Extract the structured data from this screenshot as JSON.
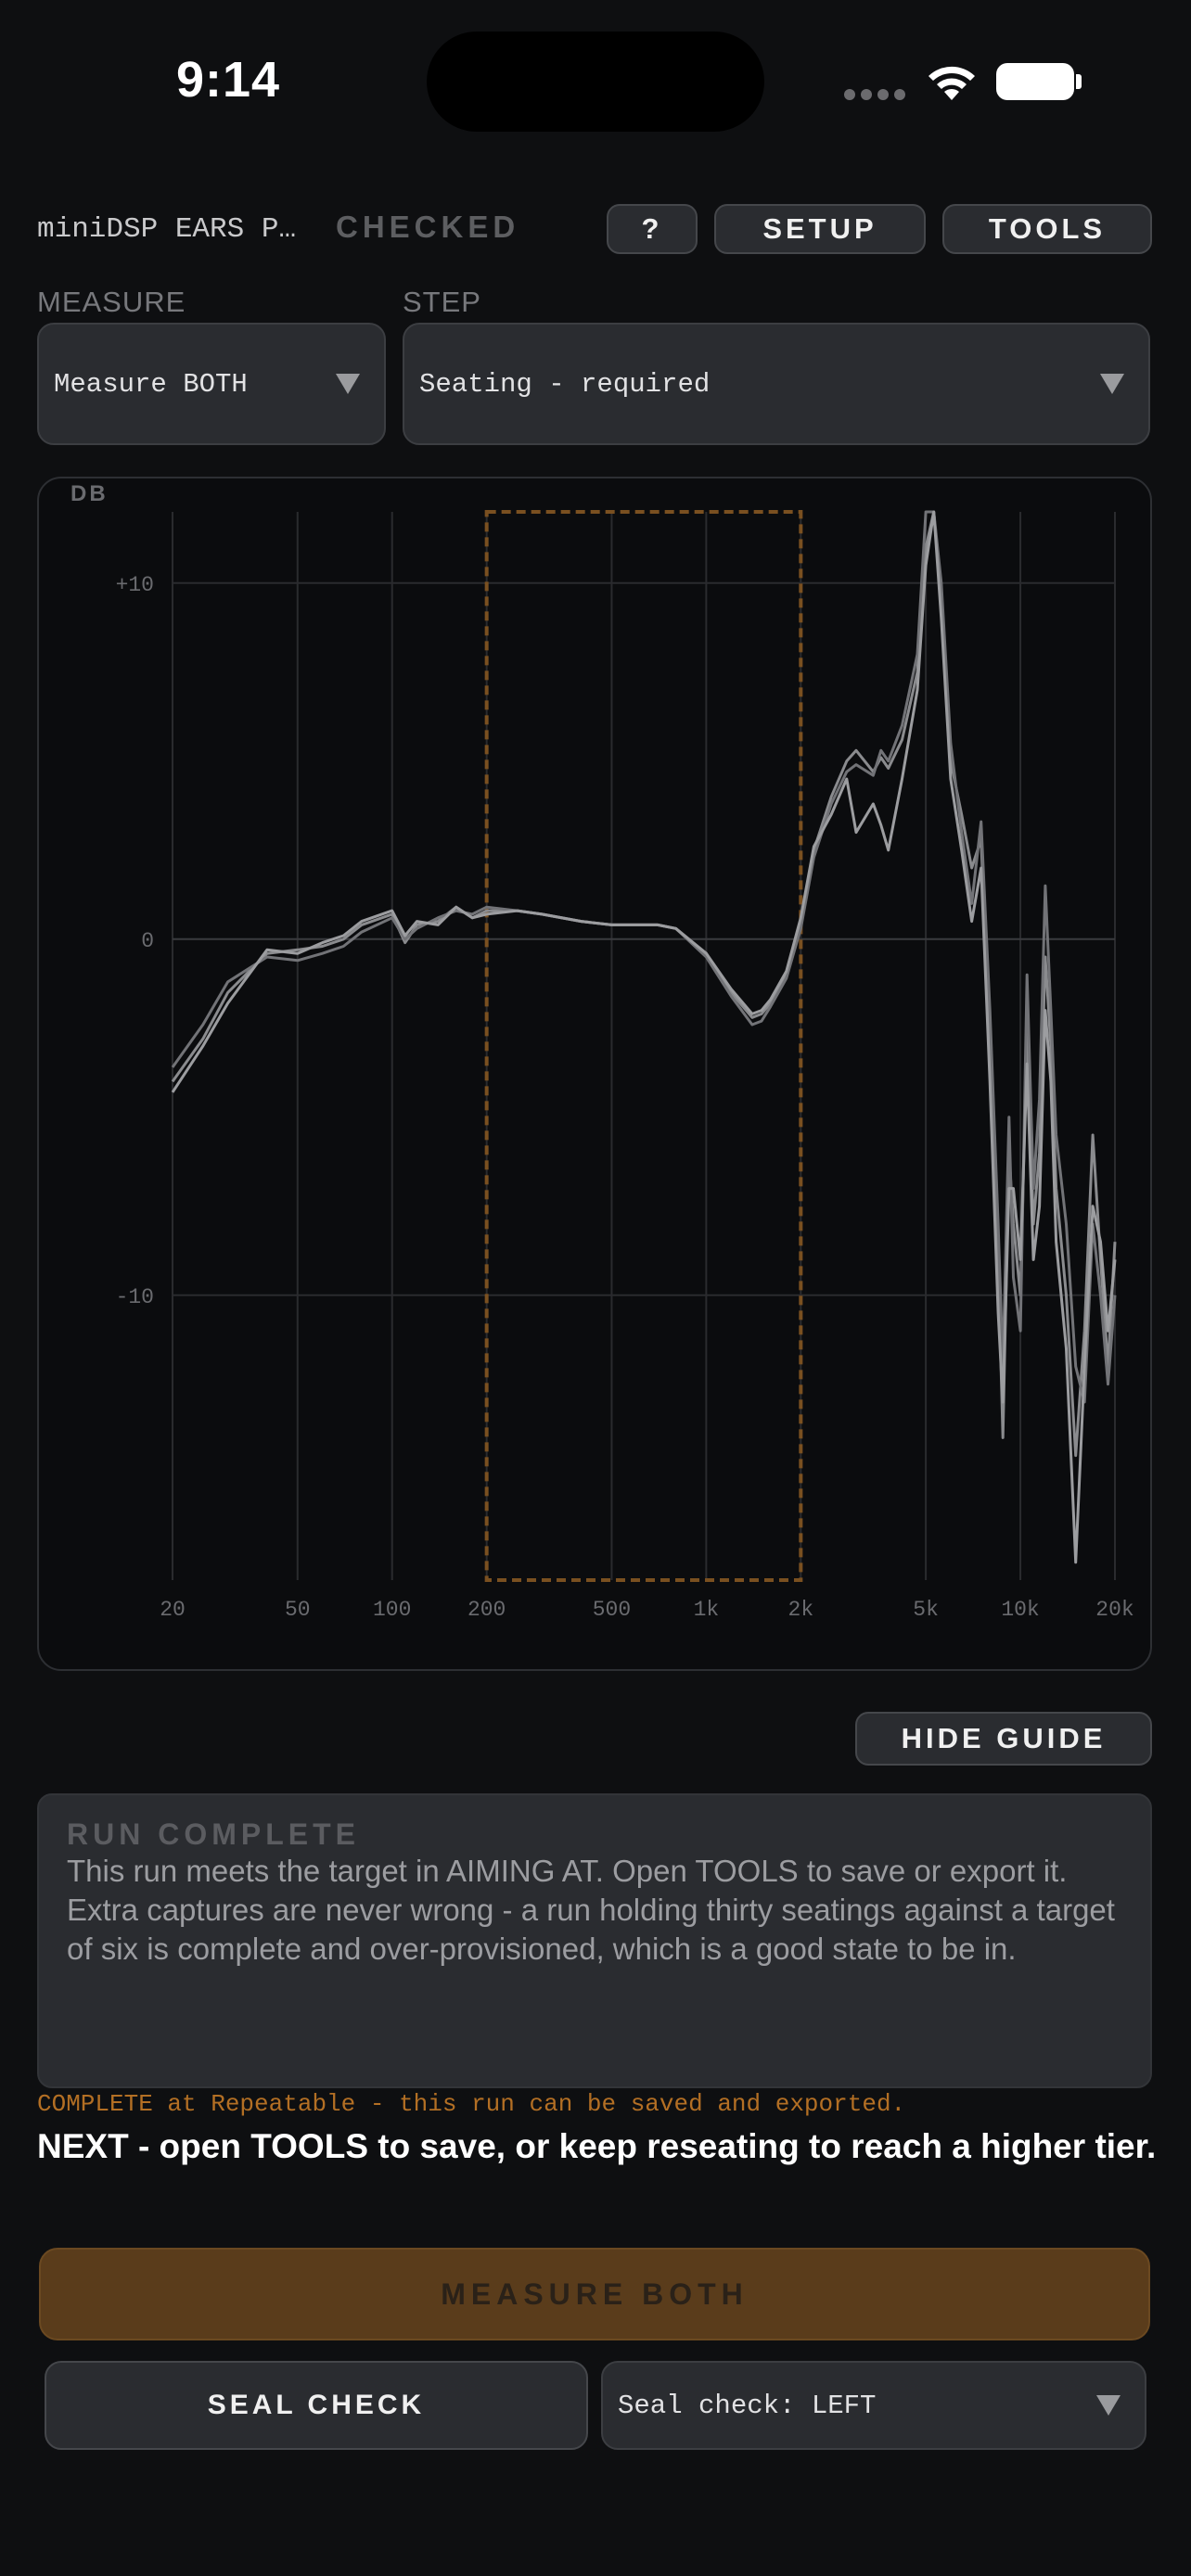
{
  "status_bar": {
    "time": "9:14"
  },
  "header": {
    "device_name": "miniDSP EARS P…",
    "status": "CHECKED",
    "help_label": "?",
    "setup_label": "SETUP",
    "tools_label": "TOOLS"
  },
  "measure": {
    "label": "MEASURE",
    "value": "Measure BOTH"
  },
  "step": {
    "label": "STEP",
    "value": "Seating - required"
  },
  "chart_data": {
    "type": "line",
    "ylabel": "DB",
    "x_scale": "log",
    "xlim": [
      20,
      20000
    ],
    "ylim": [
      -18,
      12
    ],
    "y_ticks": [
      "+10",
      "0",
      "-10"
    ],
    "y_tick_values": [
      10,
      0,
      -10
    ],
    "x_ticks": [
      "20",
      "50",
      "100",
      "200",
      "500",
      "1k",
      "2k",
      "5k",
      "10k",
      "20k"
    ],
    "x_tick_values": [
      20,
      50,
      100,
      200,
      500,
      1000,
      2000,
      5000,
      10000,
      20000
    ],
    "highlight_range": [
      200,
      2000
    ],
    "grid": true,
    "series": [
      {
        "x": [
          20,
          25,
          30,
          40,
          50,
          60,
          70,
          80,
          100,
          110,
          120,
          140,
          160,
          180,
          200,
          250,
          300,
          400,
          500,
          600,
          700,
          800,
          1000,
          1200,
          1400,
          1500,
          1600,
          1800,
          2000,
          2200,
          2500,
          2800,
          3000,
          3400,
          3600,
          3800,
          4200,
          4700,
          5000,
          5300,
          5600,
          6000,
          6500,
          7000,
          7500,
          8000,
          8500,
          8800,
          9200,
          9500,
          10000,
          10500,
          11000,
          11500,
          12000,
          12500,
          13000,
          14000,
          15000,
          16000,
          17000,
          18000,
          19000,
          20000
        ],
        "y": [
          -4.0,
          -2.8,
          -1.5,
          -0.4,
          -0.3,
          -0.2,
          0.0,
          0.4,
          0.7,
          -0.1,
          0.4,
          0.5,
          0.9,
          0.6,
          0.8,
          0.8,
          0.7,
          0.5,
          0.4,
          0.4,
          0.4,
          0.3,
          -0.4,
          -1.5,
          -2.2,
          -2.1,
          -1.8,
          -1.0,
          0.5,
          2.5,
          4.0,
          5.0,
          5.3,
          4.7,
          5.1,
          4.8,
          5.6,
          7.5,
          11.0,
          12.0,
          9.5,
          5.0,
          3.5,
          2.0,
          2.8,
          -3.0,
          -9.0,
          -14.0,
          -6.0,
          -8.0,
          -10.0,
          -2.5,
          -8.0,
          -6.0,
          -0.5,
          -3.0,
          -7.0,
          -10.0,
          -14.5,
          -11.0,
          -5.5,
          -9.0,
          -12.0,
          -8.5
        ]
      },
      {
        "x": [
          20,
          25,
          30,
          40,
          50,
          60,
          70,
          80,
          100,
          110,
          120,
          140,
          160,
          180,
          200,
          250,
          300,
          400,
          500,
          600,
          700,
          800,
          1000,
          1200,
          1400,
          1500,
          1600,
          1800,
          2000,
          2200,
          2500,
          2800,
          3000,
          3400,
          3600,
          3800,
          4200,
          4700,
          5000,
          5300,
          5600,
          6000,
          6500,
          7000,
          7500,
          8000,
          8500,
          8800,
          9200,
          9500,
          10000,
          10500,
          11000,
          11500,
          12000,
          12500,
          13000,
          14000,
          15000,
          16000,
          17000,
          18000,
          19000,
          20000
        ],
        "y": [
          -3.6,
          -2.4,
          -1.2,
          -0.5,
          -0.6,
          -0.4,
          -0.2,
          0.2,
          0.6,
          0.0,
          0.3,
          0.6,
          0.8,
          0.7,
          0.9,
          0.8,
          0.7,
          0.5,
          0.4,
          0.4,
          0.4,
          0.3,
          -0.5,
          -1.6,
          -2.4,
          -2.3,
          -1.9,
          -1.1,
          0.3,
          2.3,
          3.8,
          4.7,
          4.9,
          4.6,
          5.3,
          5.0,
          6.0,
          8.0,
          12.0,
          12.0,
          10.0,
          5.5,
          3.0,
          1.0,
          3.3,
          -2.0,
          -8.0,
          -12.0,
          -5.0,
          -9.5,
          -11.0,
          -1.0,
          -7.0,
          -4.5,
          1.5,
          -2.0,
          -5.5,
          -8.0,
          -12.0,
          -13.0,
          -8.0,
          -10.0,
          -12.5,
          -10.0
        ]
      },
      {
        "x": [
          20,
          25,
          30,
          40,
          50,
          60,
          70,
          80,
          100,
          110,
          120,
          140,
          160,
          180,
          200,
          250,
          300,
          400,
          500,
          600,
          700,
          800,
          1000,
          1200,
          1400,
          1500,
          1600,
          1800,
          2000,
          2200,
          2500,
          2800,
          3000,
          3400,
          3600,
          3800,
          4200,
          4700,
          5000,
          5300,
          5600,
          6000,
          6500,
          7000,
          7500,
          8000,
          8500,
          8800,
          9200,
          9500,
          10000,
          10500,
          11000,
          11500,
          12000,
          12500,
          13000,
          14000,
          15000,
          16000,
          17000,
          18000,
          19000,
          20000
        ],
        "y": [
          -4.3,
          -3.0,
          -1.8,
          -0.3,
          -0.4,
          -0.1,
          0.1,
          0.5,
          0.8,
          0.1,
          0.5,
          0.4,
          0.9,
          0.6,
          0.7,
          0.8,
          0.7,
          0.5,
          0.4,
          0.4,
          0.4,
          0.3,
          -0.4,
          -1.4,
          -2.1,
          -2.0,
          -1.7,
          -0.9,
          0.6,
          2.6,
          3.5,
          4.5,
          3.0,
          3.8,
          3.2,
          2.5,
          4.5,
          7.0,
          10.5,
          12.0,
          9.0,
          4.5,
          2.5,
          0.5,
          2.0,
          -4.0,
          -10.5,
          -13.0,
          -7.0,
          -7.0,
          -9.0,
          -3.5,
          -9.0,
          -7.5,
          -2.0,
          -4.0,
          -8.5,
          -11.5,
          -17.5,
          -12.0,
          -7.5,
          -8.5,
          -11.0,
          -9.0
        ]
      }
    ]
  },
  "guide": {
    "hide_label": "HIDE GUIDE",
    "title": "RUN COMPLETE",
    "line1": "This run meets the target in AIMING AT. Open TOOLS to save or export it.",
    "line2": "Extra captures are never wrong - a run holding thirty seatings against a target of six is complete and over-provisioned, which is a good state to be in."
  },
  "status_line": "COMPLETE at Repeatable - this run can be saved and exported.",
  "next_line": "NEXT - open TOOLS to save, or keep reseating to reach a higher tier.",
  "actions": {
    "measure_label": "MEASURE BOTH",
    "seal_check_label": "SEAL CHECK",
    "seal_select_value": "Seal check: LEFT"
  },
  "colors": {
    "accent": "#b36f24",
    "button_bg": "#2a2c30",
    "bg": "#0e0f11",
    "trace": "#8a8b8e"
  }
}
